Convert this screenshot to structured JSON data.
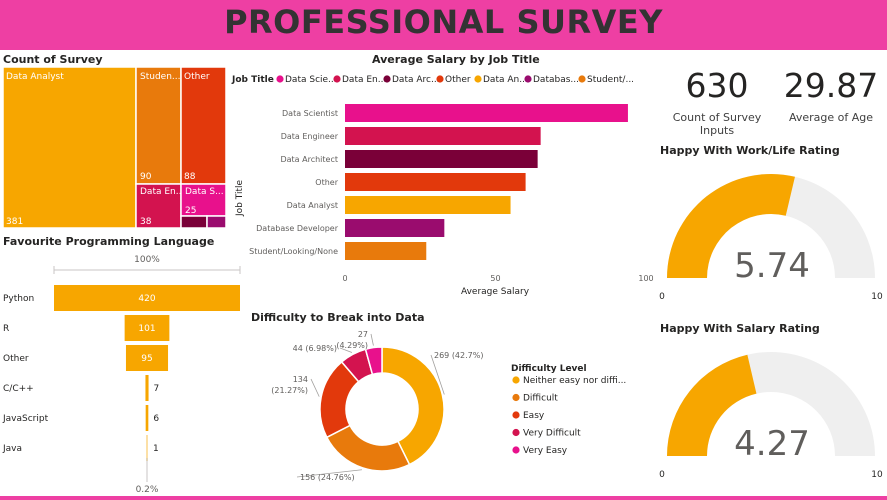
{
  "header": {
    "title": "PROFESSIONAL SURVEY"
  },
  "colors": {
    "brand": "#ee3fa3",
    "gauge_fill": "#f7a600",
    "gauge_track": "#efefef",
    "data_scientist": "#e8118c",
    "data_engineer": "#d3134f",
    "data_architect": "#7a0038",
    "other": "#e2390c",
    "data_analyst": "#f7a600",
    "database_developer": "#9a0c6e",
    "student": "#e87a0c"
  },
  "kpis": {
    "count": {
      "value": "630",
      "label": "Count of Survey Inputs"
    },
    "age": {
      "value": "29.87",
      "label": "Average of Age"
    }
  },
  "chart_data": [
    {
      "id": "treemap",
      "type": "treemap",
      "title": "Count of Survey",
      "items": [
        {
          "label": "Data Analyst",
          "value": 381
        },
        {
          "label": "Studen...",
          "value": 90
        },
        {
          "label": "Other",
          "value": 88
        },
        {
          "label": "Data En...",
          "value": 38
        },
        {
          "label": "Data S...",
          "value": 25
        },
        {
          "label": "",
          "value": 5
        },
        {
          "label": "",
          "value": 3
        }
      ]
    },
    {
      "id": "salary",
      "type": "bar",
      "title": "Average Salary by Job Title",
      "legend_title": "Job Title",
      "legend": [
        "Data Scie...",
        "Data En...",
        "Data Arc...",
        "Other",
        "Data An...",
        "Databas...",
        "Student/..."
      ],
      "categories": [
        "Data Scientist",
        "Data Engineer",
        "Data Architect",
        "Other",
        "Data Analyst",
        "Database Developer",
        "Student/Looking/None"
      ],
      "values": [
        94,
        65,
        64,
        60,
        55,
        33,
        27
      ],
      "xlabel": "Average Salary",
      "ylabel": "Job Title",
      "xticks": [
        "0",
        "50",
        "100"
      ],
      "xlim": [
        0,
        100
      ]
    },
    {
      "id": "language",
      "type": "bar",
      "title": "Favourite Programming Language",
      "top_label": "100%",
      "bottom_label": "0.2%",
      "categories": [
        "Python",
        "R",
        "Other",
        "C/C++",
        "JavaScript",
        "Java"
      ],
      "values": [
        420,
        101,
        95,
        7,
        6,
        1
      ]
    },
    {
      "id": "difficulty",
      "type": "pie",
      "title": "Difficulty to Break into Data",
      "legend_title": "Difficulty Level",
      "slices": [
        {
          "label": "Neither easy nor diffi...",
          "value": 269,
          "text": "269 (42.7%)"
        },
        {
          "label": "Difficult",
          "value": 156,
          "text": "156 (24.76%)"
        },
        {
          "label": "Easy",
          "value": 134,
          "text": "134 (21.27%)"
        },
        {
          "label": "Very Difficult",
          "value": 44,
          "text": "44 (6.98%)"
        },
        {
          "label": "Very Easy",
          "value": 27,
          "text": "27 (4.29%)"
        }
      ]
    },
    {
      "id": "gauge_work",
      "type": "gauge",
      "title": "Happy With Work/Life Rating",
      "value": 5.74,
      "value_label": "5.74",
      "min": 0,
      "max": 10,
      "min_label": "0",
      "max_label": "10"
    },
    {
      "id": "gauge_salary",
      "type": "gauge",
      "title": "Happy With Salary Rating",
      "value": 4.27,
      "value_label": "4.27",
      "min": 0,
      "max": 10,
      "min_label": "0",
      "max_label": "10"
    }
  ]
}
